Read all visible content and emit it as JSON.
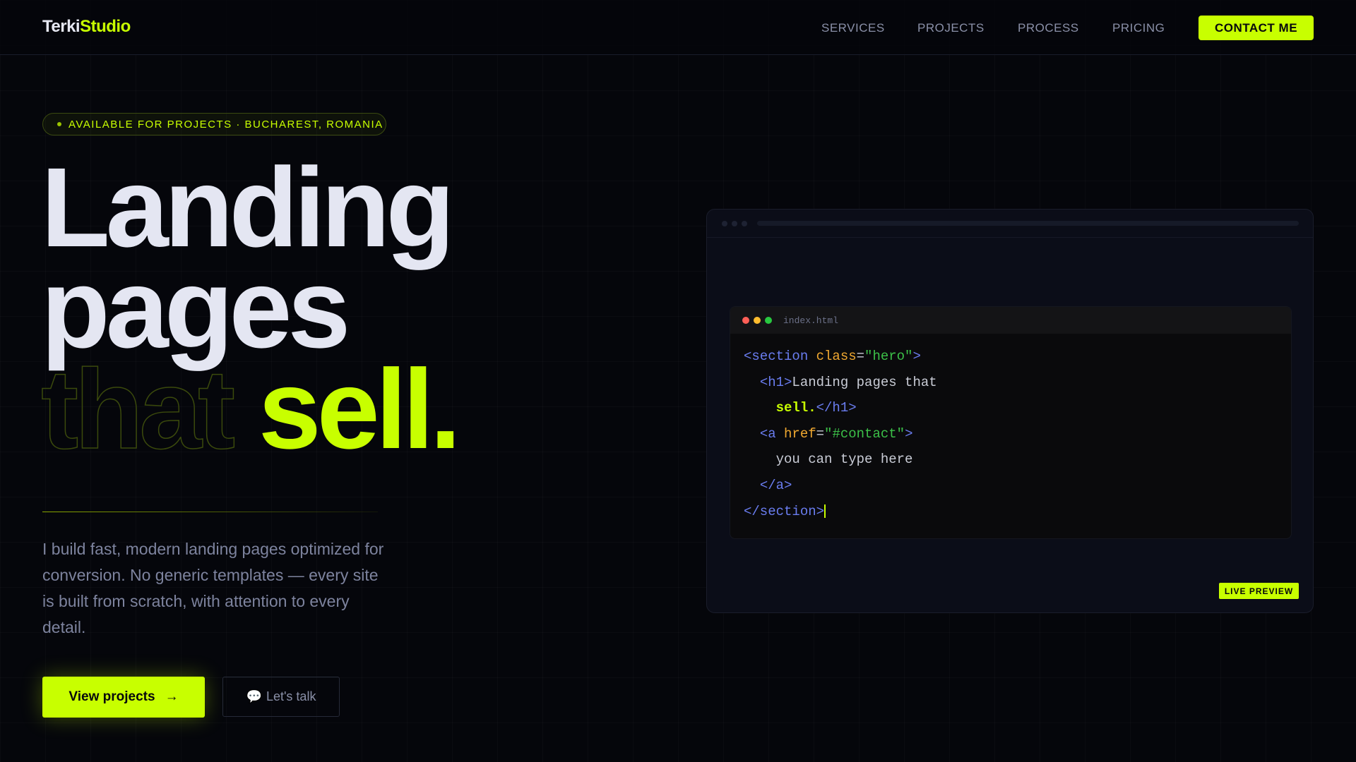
{
  "nav": {
    "logo_a": "Terki",
    "logo_b": "Studio",
    "links": [
      "SERVICES",
      "PROJECTS",
      "PROCESS",
      "PRICING"
    ],
    "cta": "CONTACT ME"
  },
  "hero": {
    "badge": "AVAILABLE FOR PROJECTS · BUCHAREST, ROMANIA",
    "line1": "Landing",
    "line2": "pages",
    "line3a": "that",
    "line3b": "sell.",
    "paragraph": "I build fast, modern landing pages optimized for conversion. No generic templates — every site is built from scratch, with attention to every detail.",
    "primary": "View projects",
    "primary_arrow": "→",
    "secondary_icon": "💬",
    "secondary": "Let's talk"
  },
  "preview": {
    "filename": "index.html",
    "live": "LIVE PREVIEW",
    "code": {
      "l1a": "<section ",
      "l1b": "class",
      "l1c": "=",
      "l1d": "\"hero\"",
      "l1e": ">",
      "l2a": "<h1>",
      "l2b": "Landing pages that",
      "l3a": "sell.",
      "l3b": "</h1>",
      "l4a": "<a ",
      "l4b": "href",
      "l4c": "=",
      "l4d": "\"#contact\"",
      "l4e": ">",
      "l5": "you can type here",
      "l6": "</a>",
      "l7": "</section>"
    }
  },
  "colors": {
    "accent": "#c8ff00",
    "bg": "#05060b"
  }
}
